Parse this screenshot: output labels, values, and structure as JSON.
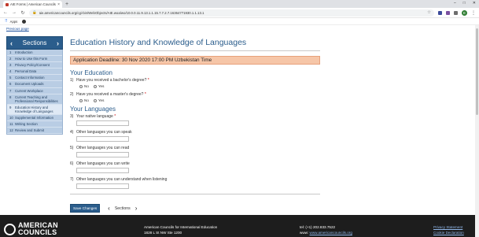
{
  "browser": {
    "tab_title": "AIE Forms | American Councils",
    "new_tab": "+",
    "url": "aie.americancouncils.org/cgi-bin/WebObjects/AIE.woa/wo/10.0.0.11.9.13.1.1.15.7.7.2.7.16364771930.1.1.13.1",
    "window_controls": [
      "–",
      "□",
      "✕"
    ],
    "bookmark_apps": "Apps",
    "avatar_initial": "E"
  },
  "page": {
    "previous_link": "Previous page",
    "sections_label": "Sections",
    "sidebar_items": [
      {
        "num": "1",
        "label": "Introduction"
      },
      {
        "num": "2",
        "label": "How to Use this Form"
      },
      {
        "num": "3",
        "label": "Privacy Policy/Consent"
      },
      {
        "num": "4",
        "label": "Personal Data"
      },
      {
        "num": "5",
        "label": "Contact Information"
      },
      {
        "num": "6",
        "label": "Document Uploads"
      },
      {
        "num": "7",
        "label": "Current Workplace"
      },
      {
        "num": "8",
        "label": "Current Teaching and Professional Responsibilities"
      },
      {
        "num": "9",
        "label": "Education History and Knowledge of Languages"
      },
      {
        "num": "10",
        "label": "Supplemental Information"
      },
      {
        "num": "11",
        "label": "Writing Section"
      },
      {
        "num": "12",
        "label": "Review and Submit"
      }
    ],
    "title": "Education History and Knowledge of Languages",
    "deadline": "Application Deadline: 30 Nov 2020 17:00 PM Uzbekistan Time",
    "education_heading": "Your Education",
    "q1": {
      "num": "1)",
      "text": "Have you received a bachelor's degree?",
      "required": "*",
      "opt_no": "No",
      "opt_yes": "Yes"
    },
    "q2": {
      "num": "2)",
      "text": "Have you received a master's degree?",
      "required": "*",
      "opt_no": "No",
      "opt_yes": "Yes"
    },
    "languages_heading": "Your Languages",
    "q3": {
      "num": "3)",
      "text": "Your native language",
      "required": "*"
    },
    "q4": {
      "num": "4)",
      "text": "Other languages you can speak"
    },
    "q5": {
      "num": "5)",
      "text": "Other languages you can read"
    },
    "q6": {
      "num": "6)",
      "text": "Other languages you can write"
    },
    "q7": {
      "num": "7)",
      "text": "Other languages you can understand when listening"
    },
    "save_button": "Save Changes",
    "sections_nav": "Sections"
  },
  "footer": {
    "logo_line1": "AMERICAN",
    "logo_line2": "COUNCILS",
    "org_name": "American Councils for International Education",
    "address": "1828 L St NW Ste 1200",
    "phone": "tel: (+1) 202.833.7522",
    "web_prefix": "www:",
    "web": "www.americancouncils.org",
    "privacy": "Privacy Statement",
    "cookie": "Cookie Declaration"
  },
  "colors": {
    "accent": "#2b5d8c",
    "deadline_bg": "#f6c6a8",
    "sidebar_bg": "#b9cde4"
  }
}
